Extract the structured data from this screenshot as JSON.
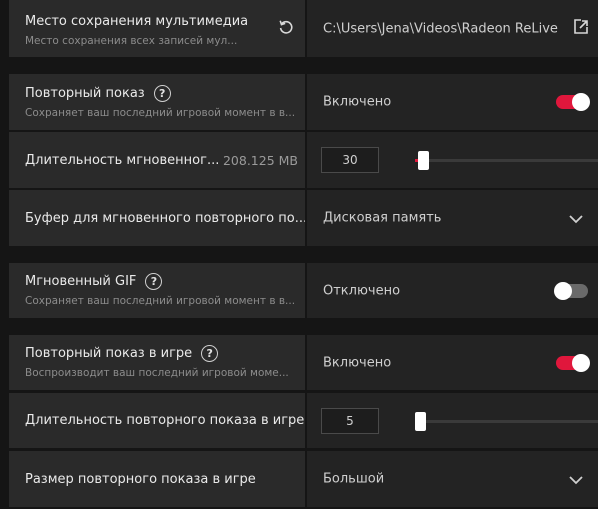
{
  "media_location": {
    "title": "Место сохранения мультимедиа",
    "subtitle": "Место сохранения всех записей мул...",
    "path": "C:\\Users\\Jena\\Videos\\Radeon ReLive",
    "reset_icon": "reset-icon",
    "browse_icon": "folder-open-icon"
  },
  "instant_replay": {
    "title": "Повторный показ",
    "subtitle": "Сохраняет ваш последний игровой момент в в...",
    "value": "Включено",
    "enabled": true
  },
  "instant_replay_duration": {
    "title": "Длительность мгновенног...",
    "size": "208.125 MB",
    "value": "30",
    "level": 0.02
  },
  "instant_replay_buffer": {
    "title": "Буфер для мгновенного повторного по...",
    "value": "Дисковая память"
  },
  "instant_gif": {
    "title": "Мгновенный GIF",
    "subtitle": "Сохраняет ваш последний игровой момент в в...",
    "value": "Отключено",
    "enabled": false
  },
  "in_game_replay": {
    "title": "Повторный показ в игре",
    "subtitle": "Воспроизводит ваш последний игровой моме...",
    "value": "Включено",
    "enabled": true
  },
  "in_game_replay_duration": {
    "title": "Длительность повторного показа в игре...",
    "value": "5",
    "level": 0.0
  },
  "in_game_replay_size": {
    "title": "Размер повторного показа в игре",
    "value": "Большой"
  },
  "colors": {
    "accent": "#e0173c",
    "panel": "#2a2a2a",
    "panel_right": "#232323",
    "background": "#151515"
  }
}
